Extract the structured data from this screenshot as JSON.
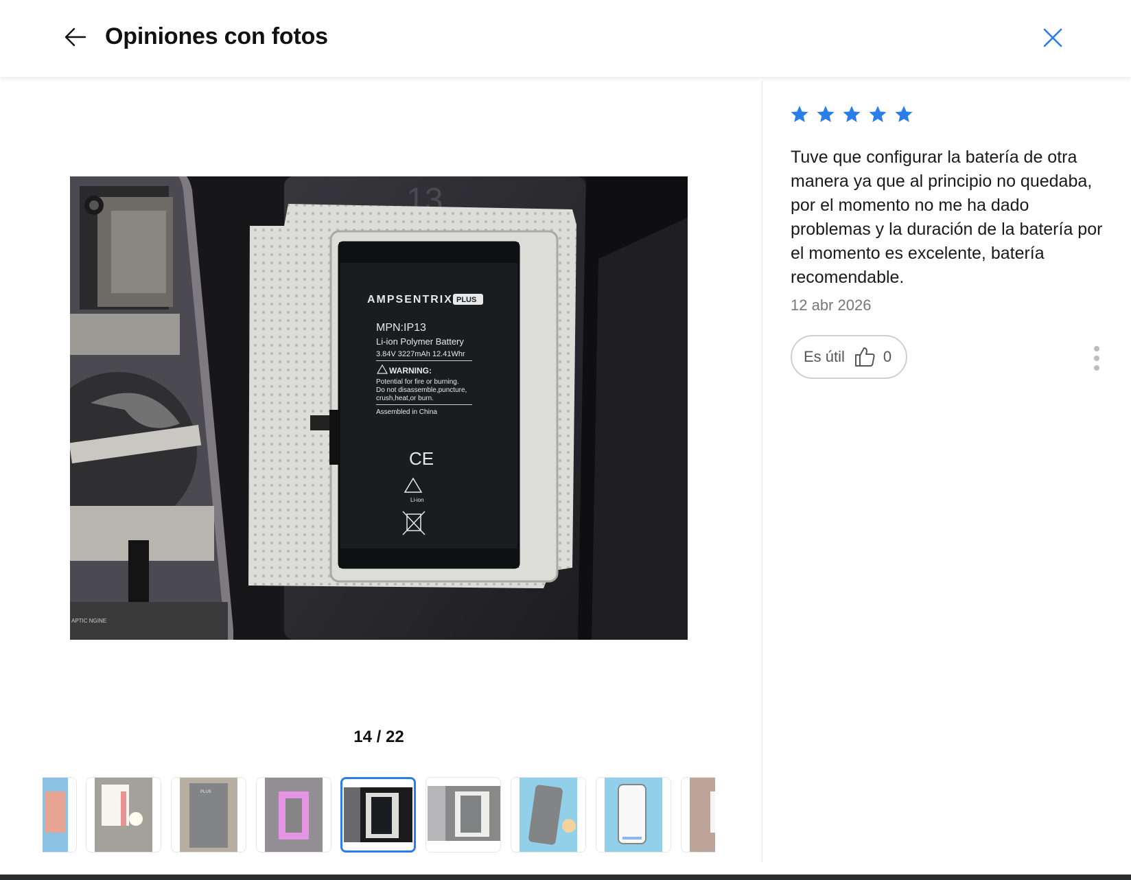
{
  "header": {
    "title": "Opiniones con fotos",
    "back_icon": "arrow-left-icon",
    "close_icon": "close-icon"
  },
  "colors": {
    "accent": "#2b7de9",
    "star": "#2b7de9",
    "text": "#1a1a1a",
    "muted": "#777777"
  },
  "photo": {
    "battery_brand": "AMPSENTRIX",
    "battery_brand_badge": "PLUS",
    "battery_mpn": "MPN:IP13",
    "battery_type": "Li-ion Polymer Battery",
    "battery_specs": "3.84V 3227mAh 12.41Whr",
    "battery_warning": "WARNING:",
    "battery_warning_line1": "Potential for fire or burning.",
    "battery_warning_line2": "Do not disassemble,puncture,",
    "battery_warning_line3": "crush,heat,or burn.",
    "battery_origin": "Assembled in China",
    "battery_ce": "CE",
    "battery_recycle": "Li-ion",
    "tray_number": "13",
    "phone_label": "APTIC NGINE"
  },
  "gallery": {
    "current": "14",
    "separator": "/",
    "total": "22",
    "thumbnails": [
      {
        "name": "thumb-12"
      },
      {
        "name": "thumb-13"
      },
      {
        "name": "thumb-14"
      },
      {
        "name": "thumb-15"
      },
      {
        "name": "thumb-16"
      },
      {
        "name": "thumb-17"
      },
      {
        "name": "thumb-18"
      },
      {
        "name": "thumb-19"
      },
      {
        "name": "thumb-20"
      }
    ],
    "thumb_16_brand": "PLUS"
  },
  "review": {
    "rating": 5,
    "max_rating": 5,
    "text": "Tuve que configurar la batería de otra manera ya que al principio no quedaba, por el momento no me ha dado problemas y la duración de la batería por el momento es excelente, batería recomendable.",
    "date": "12 abr 2026",
    "helpful_label": "Es útil",
    "helpful_icon": "thumbs-up-icon",
    "helpful_count": "0",
    "more_icon": "more-vertical-icon"
  }
}
